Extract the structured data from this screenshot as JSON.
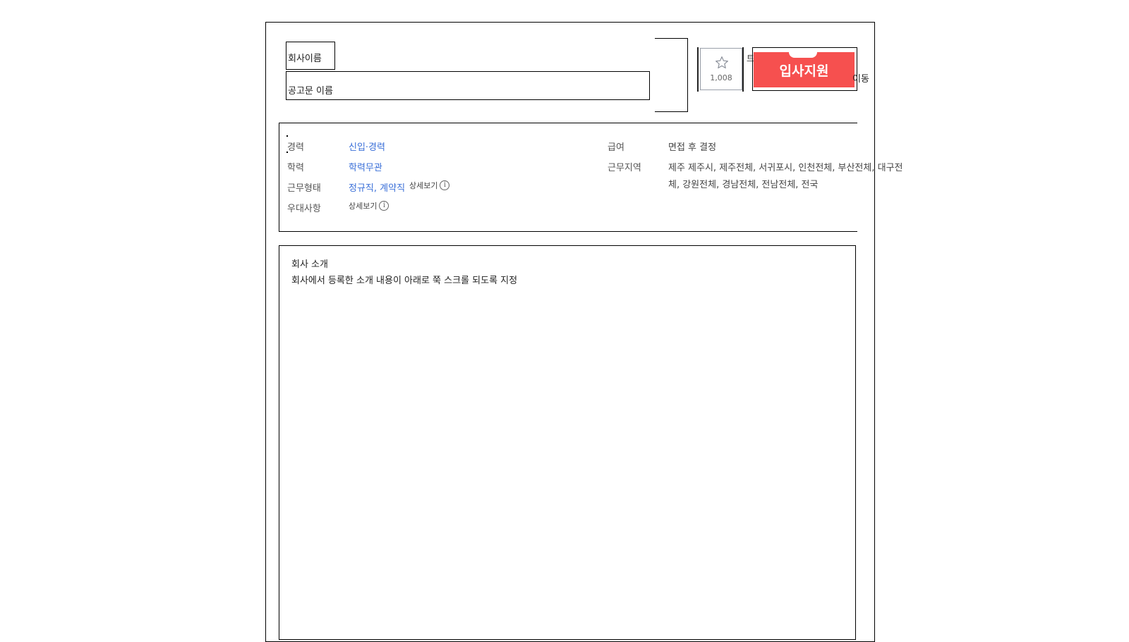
{
  "header": {
    "company_name": "회사이름",
    "posting_title": "공고문 이름",
    "favorite": {
      "icon": "star-icon",
      "count": "1,008"
    },
    "apply_button_label": "입사지원",
    "move_label": "이동",
    "stray_char": "트"
  },
  "conditions": {
    "left": [
      {
        "label": "경력",
        "value": "신입·경력"
      },
      {
        "label": "학력",
        "value": "학력무관"
      },
      {
        "label": "근무형태",
        "value": "정규직, 계약직",
        "detail": "상세보기"
      },
      {
        "label": "우대사항",
        "detail": "상세보기"
      }
    ],
    "right": [
      {
        "label": "급여",
        "value": "면접 후 결정"
      },
      {
        "label": "근무지역",
        "value_line1": "제주 제주시, 제주전체, 서귀포시, 인천전체, 부산전체, 대구전",
        "value_line2": "체, 강원전체, 경남전체, 전남전체, 전국"
      }
    ],
    "info_icon": "info-icon"
  },
  "intro": {
    "title": "회사 소개",
    "body": "회사에서 등록한 소개 내용이 아래로 쭉 스크롤 되도록 지정"
  },
  "colors": {
    "accent_red": "#f6504f",
    "link_blue": "#3a6fd8"
  }
}
